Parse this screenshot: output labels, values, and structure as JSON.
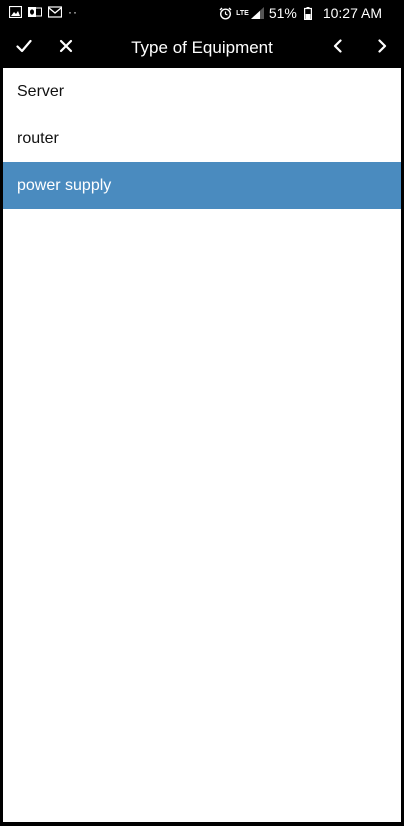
{
  "status_bar": {
    "dots": "··",
    "network": "LTE",
    "battery": "51%",
    "time": "10:27 AM"
  },
  "toolbar": {
    "title": "Type of Equipment"
  },
  "list": {
    "items": [
      {
        "label": "Server",
        "selected": false
      },
      {
        "label": "router",
        "selected": false
      },
      {
        "label": "power supply",
        "selected": true
      }
    ]
  },
  "colors": {
    "background": "#000000",
    "content": "#ffffff",
    "selected": "#4a8bbf"
  }
}
